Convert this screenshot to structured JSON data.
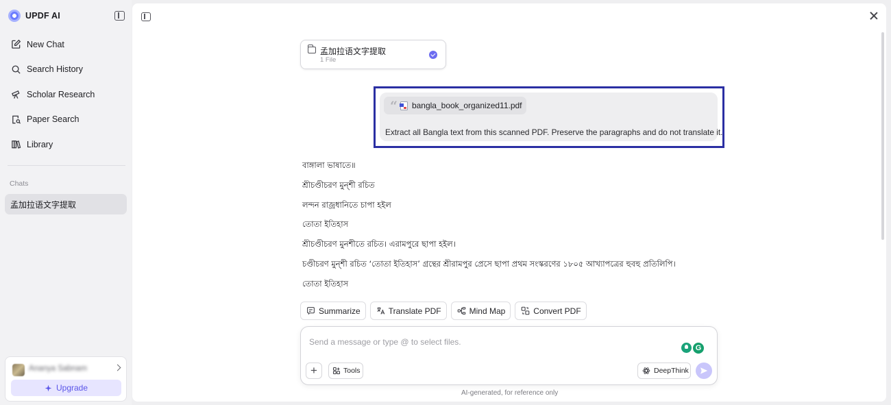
{
  "brand": {
    "name": "UPDF AI"
  },
  "sidebar": {
    "items": [
      {
        "label": "New Chat",
        "icon": "edit-icon"
      },
      {
        "label": "Search History",
        "icon": "search-icon"
      },
      {
        "label": "Scholar Research",
        "icon": "telescope-icon"
      },
      {
        "label": "Paper Search",
        "icon": "document-search-icon"
      },
      {
        "label": "Library",
        "icon": "library-icon"
      }
    ],
    "chats_label": "Chats",
    "chats": [
      {
        "label": "孟加拉语文字提取"
      }
    ]
  },
  "account": {
    "name": "Ananya Sabnam",
    "upgrade_label": "Upgrade"
  },
  "knowledge_base": {
    "title": "孟加拉语文字提取",
    "subtitle": "1 File"
  },
  "user_message": {
    "attachment": "bangla_book_organized11.pdf",
    "text": "Extract all Bangla text from this scanned PDF. Preserve the paragraphs and do not translate it."
  },
  "response_lines": [
    "বাঙ্গালা ভাষাতে॥",
    "শ্রীচণ্ডীচরণ মুন্শী রচিত",
    "লন্দন রাজ্রধানিতে চাপা হইল",
    "তোতা ইতিহাস",
    "শ্রীচণ্ডীচরণ মুনশীতে রচিত। এরামপুরে ছাপা হইল।",
    "চণ্ডীচরণ মুন্শী রচিত   ‘তোতা ইতিহাস’   গ্রন্থের শ্রীরামপুর প্রেসে ছাপা প্রথম সংস্করণের ১৮০৫ আখ্যাপত্রের হুবহু প্রতিলিপি।",
    "তোতা ইতিহাস"
  ],
  "quick_actions": [
    {
      "label": "Summarize",
      "icon": "summarize-icon"
    },
    {
      "label": "Translate PDF",
      "icon": "translate-icon"
    },
    {
      "label": "Mind Map",
      "icon": "mind-map-icon"
    },
    {
      "label": "Convert PDF",
      "icon": "convert-icon"
    }
  ],
  "composer": {
    "placeholder": "Send a message or type @ to select files.",
    "tools_label": "Tools",
    "deepthink_label": "DeepThink",
    "assist_letter": "G"
  },
  "disclaimer": "AI-generated, for reference only",
  "colors": {
    "accent": "#6c6cf0",
    "highlight_border": "#2b2fa3",
    "upgrade_bg": "#e7e5ff"
  }
}
